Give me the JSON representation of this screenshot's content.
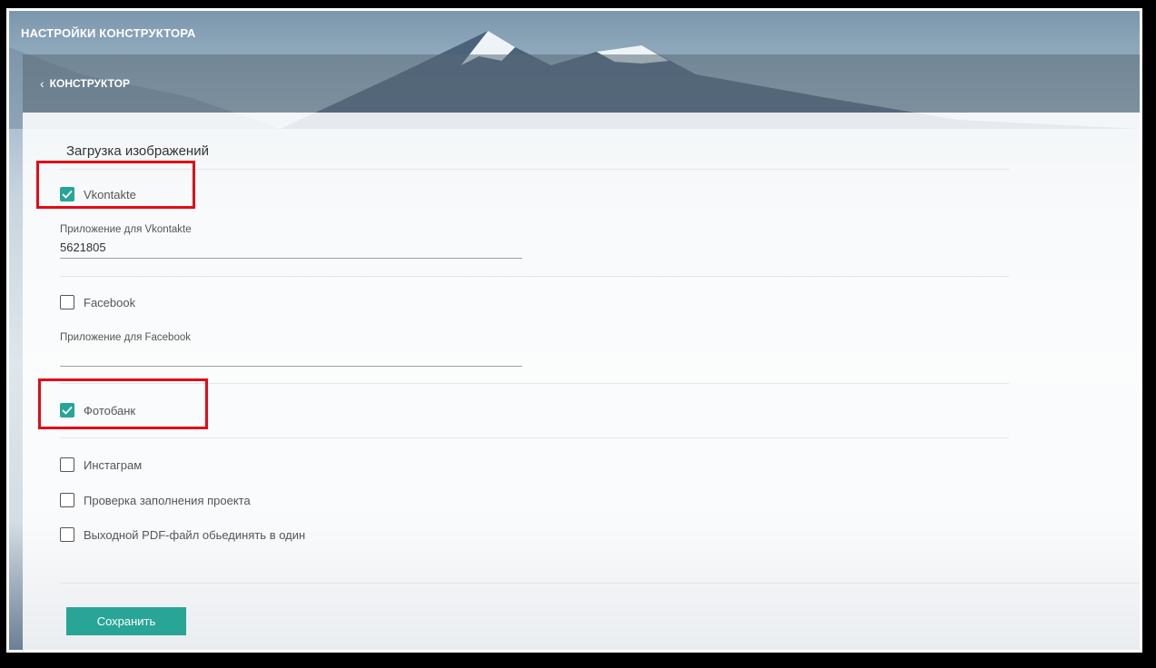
{
  "app": {
    "title": "НАСТРОЙКИ КОНСТРУКТОРА"
  },
  "nav": {
    "back_label": "КОНСТРУКТОР"
  },
  "section": {
    "title": "Загрузка изображений"
  },
  "options": {
    "vkontakte": {
      "label": "Vkontakte",
      "checked": true
    },
    "vk_app": {
      "label": "Приложение для Vkontakte",
      "value": "5621805"
    },
    "facebook": {
      "label": "Facebook",
      "checked": false
    },
    "fb_app": {
      "label": "Приложение для Facebook",
      "value": ""
    },
    "photobank": {
      "label": "Фотобанк",
      "checked": true
    },
    "instagram": {
      "label": "Инстаграм",
      "checked": false
    },
    "project_check": {
      "label": "Проверка заполнения проекта",
      "checked": false
    },
    "pdf_merge": {
      "label": "Выходной PDF-файл обьединять в один",
      "checked": false
    }
  },
  "actions": {
    "save_label": "Сохранить"
  },
  "colors": {
    "accent": "#28a597",
    "highlight": "#e20b16"
  },
  "icons": {
    "back": "chevron-left-icon",
    "check": "check-icon"
  }
}
